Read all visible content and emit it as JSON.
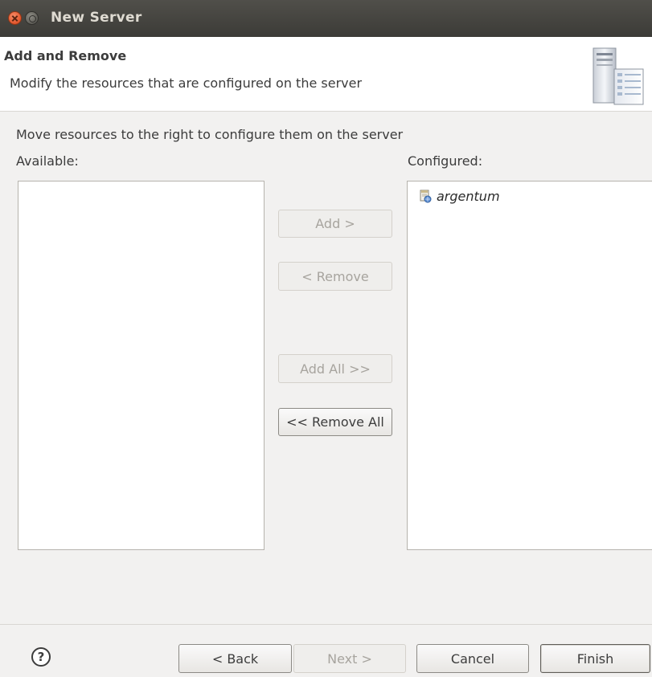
{
  "window": {
    "title": "New Server"
  },
  "header": {
    "title": "Add and Remove",
    "description": "Modify the resources that are configured on the server",
    "graphic_icon": "server-wizard-icon"
  },
  "body": {
    "instruction": "Move resources to the right to configure them on the server",
    "available_label": "Available:",
    "configured_label": "Configured:",
    "available_items": [],
    "configured_items": [
      {
        "label": "argentum",
        "icon": "web-module-icon"
      }
    ]
  },
  "buttons": {
    "add": "Add >",
    "remove": "< Remove",
    "add_all": "Add All >>",
    "remove_all": "<< Remove All"
  },
  "footer": {
    "help_glyph": "?",
    "back": "< Back",
    "next": "Next >",
    "cancel": "Cancel",
    "finish": "Finish"
  },
  "colors": {
    "titlebar": "#3c3b37",
    "close_button": "#e2552b",
    "dialog_background": "#f2f1f0"
  }
}
